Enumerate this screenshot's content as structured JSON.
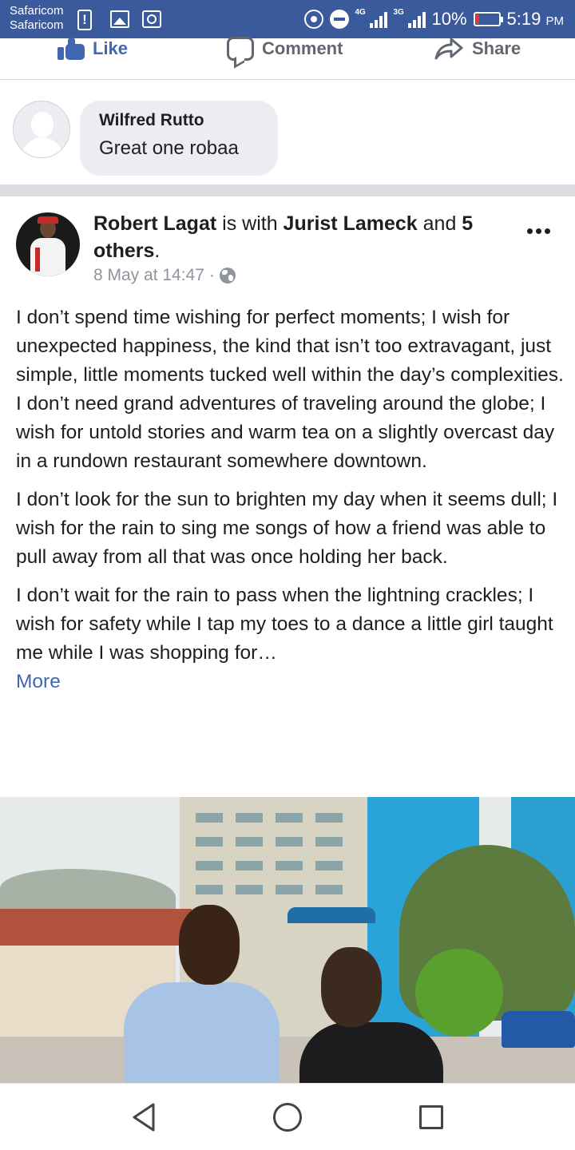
{
  "status_bar": {
    "carrier_1": "Safaricom",
    "carrier_2": "Safaricom",
    "network_1": "4G",
    "network_2": "3G",
    "battery": "10%",
    "time": "5:19",
    "ampm": "PM"
  },
  "actions": {
    "like": "Like",
    "comment": "Comment",
    "share": "Share"
  },
  "comment": {
    "author": "Wilfred Rutto",
    "text": "Great one robaa"
  },
  "post": {
    "author": "Robert Lagat",
    "with_text": " is with ",
    "tagged": "Jurist Lameck",
    "and_text": " and ",
    "others": "5 others",
    "period": ".",
    "date": "8 May at 14:47",
    "date_separator": "·",
    "paragraphs": [
      "I don’t spend time wishing for perfect moments; I wish for unexpected happiness, the kind that isn’t too extravagant, just simple, little moments tucked well within the day’s complexities.",
      "I don’t need grand adventures of traveling around the globe; I wish for untold stories and warm tea on a slightly overcast day in a rundown restaurant somewhere downtown.",
      "I don’t look for the sun to brighten my day when it seems dull; I wish for the rain to sing me songs of how a friend was able to pull away from all that was once holding her back.",
      "I don’t wait for the rain to pass when the lightning crackles; I wish for safety while I tap my toes to a dance a little girl taught me while I was shopping for…"
    ],
    "more_label": "More"
  },
  "icons": {
    "like": "thumbs-up-icon",
    "comment": "speech-bubble-icon",
    "share": "share-arrow-icon",
    "privacy": "globe-icon",
    "menu": "more-options-icon"
  },
  "colors": {
    "status_bar": "#3a5a9c",
    "link_blue": "#4267b2",
    "meta_grey": "#90949c",
    "bubble_bg": "#ebedf0",
    "battery_low": "#e53935"
  }
}
